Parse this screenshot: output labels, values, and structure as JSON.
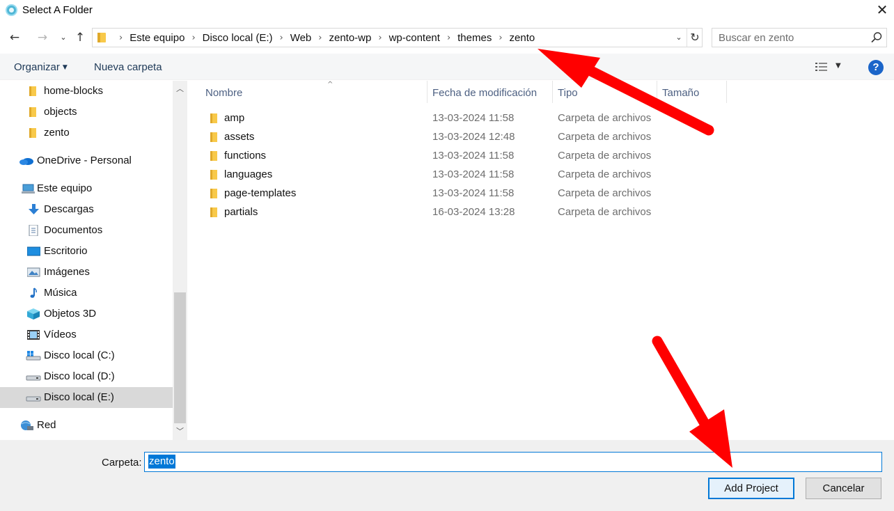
{
  "window": {
    "title": "Select A Folder",
    "close_icon": "close-icon",
    "app_icon": "app-icon"
  },
  "navigation": {
    "back_icon": "arrow-left-icon",
    "forward_icon": "arrow-right-icon",
    "recent_icon": "chevron-down-icon",
    "up_icon": "arrow-up-icon"
  },
  "address": {
    "crumbs": [
      "Este equipo",
      "Disco local (E:)",
      "Web",
      "zento-wp",
      "wp-content",
      "themes",
      "zento"
    ],
    "dropdown_icon": "chevron-down-icon",
    "refresh_icon": "refresh-icon"
  },
  "search": {
    "placeholder": "Buscar en zento",
    "icon": "search-icon"
  },
  "toolbar": {
    "organize": "Organizar",
    "new_folder": "Nueva carpeta",
    "view_icon": "view-options-icon",
    "help_icon": "help-icon",
    "help_label": "?"
  },
  "tree": {
    "items": [
      {
        "label": "home-blocks",
        "icon": "folder-icon"
      },
      {
        "label": "objects",
        "icon": "folder-icon"
      },
      {
        "label": "zento",
        "icon": "folder-icon"
      },
      {
        "label": "OneDrive - Personal",
        "icon": "onedrive-icon"
      },
      {
        "label": "Este equipo",
        "icon": "computer-icon"
      },
      {
        "label": "Descargas",
        "icon": "download-icon"
      },
      {
        "label": "Documentos",
        "icon": "documents-icon"
      },
      {
        "label": "Escritorio",
        "icon": "desktop-icon"
      },
      {
        "label": "Imágenes",
        "icon": "pictures-icon"
      },
      {
        "label": "Música",
        "icon": "music-icon"
      },
      {
        "label": "Objetos 3D",
        "icon": "3d-objects-icon"
      },
      {
        "label": "Vídeos",
        "icon": "videos-icon"
      },
      {
        "label": "Disco local (C:)",
        "icon": "drive-icon"
      },
      {
        "label": "Disco local (D:)",
        "icon": "drive-icon"
      },
      {
        "label": "Disco local (E:)",
        "icon": "drive-icon"
      },
      {
        "label": "Red",
        "icon": "network-icon"
      }
    ],
    "selected": "Disco local (E:)"
  },
  "columns": {
    "name": "Nombre",
    "modified": "Fecha de modificación",
    "type": "Tipo",
    "size": "Tamaño"
  },
  "files": [
    {
      "name": "amp",
      "modified": "13-03-2024 11:58",
      "type": "Carpeta de archivos"
    },
    {
      "name": "assets",
      "modified": "13-03-2024 12:48",
      "type": "Carpeta de archivos"
    },
    {
      "name": "functions",
      "modified": "13-03-2024 11:58",
      "type": "Carpeta de archivos"
    },
    {
      "name": "languages",
      "modified": "13-03-2024 11:58",
      "type": "Carpeta de archivos"
    },
    {
      "name": "page-templates",
      "modified": "13-03-2024 11:58",
      "type": "Carpeta de archivos"
    },
    {
      "name": "partials",
      "modified": "16-03-2024 13:28",
      "type": "Carpeta de archivos"
    }
  ],
  "footer": {
    "folder_label": "Carpeta:",
    "folder_value": "zento",
    "primary_button": "Add Project",
    "cancel_button": "Cancelar"
  },
  "colors": {
    "accent": "#0078d7",
    "folder": "#f8c94a",
    "annotation": "#ff0000"
  }
}
